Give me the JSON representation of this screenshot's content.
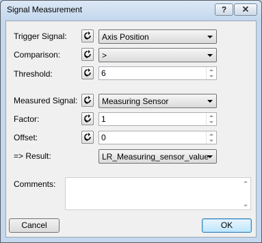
{
  "window": {
    "title": "Signal Measurement",
    "help_label": "?",
    "close_label": "✕"
  },
  "form": {
    "trigger_signal": {
      "label": "Trigger Signal:",
      "value": "Axis Position"
    },
    "comparison": {
      "label": "Comparison:",
      "value": ">"
    },
    "threshold": {
      "label": "Threshold:",
      "value": "6"
    },
    "measured_signal": {
      "label": "Measured Signal:",
      "value": "Measuring Sensor"
    },
    "factor": {
      "label": "Factor:",
      "value": "1"
    },
    "offset": {
      "label": "Offset:",
      "value": "0"
    },
    "result": {
      "label": "=> Result:",
      "value": "LR_Measuring_sensor_value"
    },
    "comments": {
      "label": "Comments:",
      "value": ""
    }
  },
  "buttons": {
    "cancel": "Cancel",
    "ok": "OK"
  },
  "icons": {
    "link": "link-toggle-icon"
  }
}
